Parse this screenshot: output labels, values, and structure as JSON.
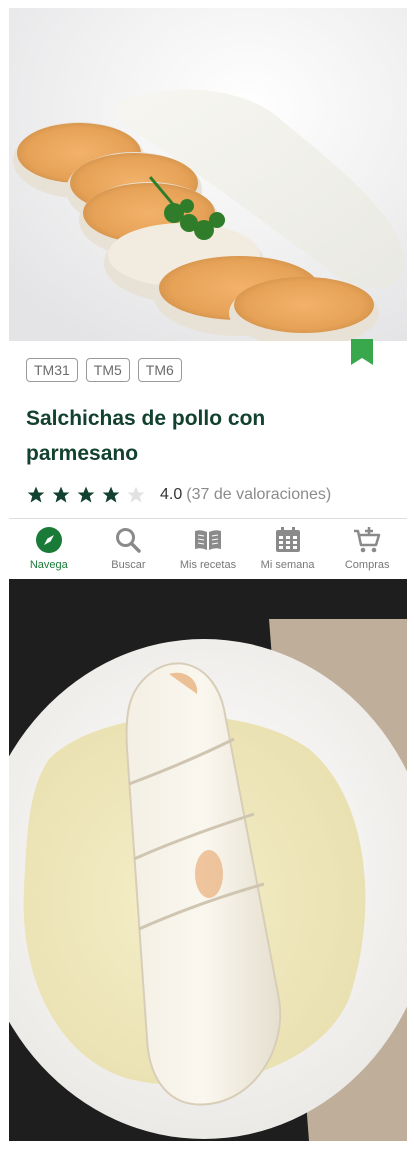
{
  "recipe": {
    "tags": [
      "TM31",
      "TM5",
      "TM6"
    ],
    "title": "Salchichas de pollo con parmesano",
    "rating_value": "4.0",
    "rating_count_text": "(37 de valoraciones)",
    "stars_filled": 4,
    "stars_total": 5
  },
  "nav": {
    "items": [
      {
        "label": "Navega",
        "icon": "compass-icon",
        "active": true
      },
      {
        "label": "Buscar",
        "icon": "search-icon",
        "active": false
      },
      {
        "label": "Mis recetas",
        "icon": "book-icon",
        "active": false
      },
      {
        "label": "Mi semana",
        "icon": "calendar-icon",
        "active": false
      },
      {
        "label": "Compras",
        "icon": "cart-icon",
        "active": false
      }
    ]
  },
  "colors": {
    "accent": "#1a7a38",
    "title": "#13412f",
    "bookmark": "#39a84d",
    "star": "#13412f"
  }
}
